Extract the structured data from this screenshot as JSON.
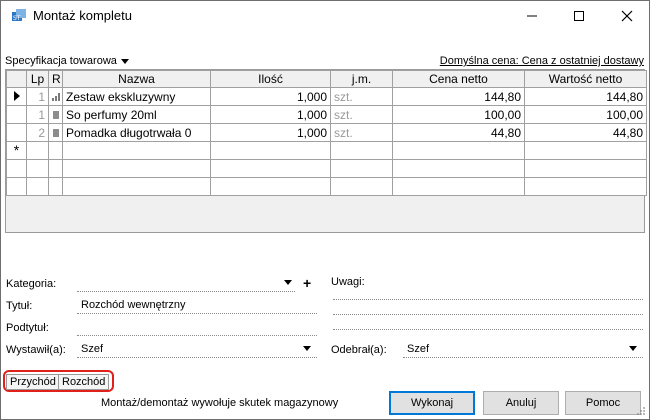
{
  "window": {
    "title": "Montaż kompletu"
  },
  "toolbar": {
    "spec_dropdown": "Specyfikacja towarowa",
    "default_price": "Domyślna cena: Cena z ostatniej dostawy"
  },
  "table": {
    "columns": [
      "Lp",
      "R",
      "Nazwa",
      "Ilość",
      "j.m.",
      "Cena netto",
      "Wartość netto"
    ],
    "rows": [
      {
        "lp": "1",
        "name": "Zestaw ekskluzywny",
        "qty": "1,000",
        "unit": "szt.",
        "price": "144,80",
        "value": "144,80"
      },
      {
        "lp": "1",
        "name": "So perfumy 20ml",
        "qty": "1,000",
        "unit": "szt.",
        "price": "100,00",
        "value": "100,00"
      },
      {
        "lp": "2",
        "name": "Pomadka długotrwała 0",
        "qty": "1,000",
        "unit": "szt.",
        "price": "44,80",
        "value": "44,80"
      }
    ]
  },
  "form": {
    "kategoria_label": "Kategoria:",
    "kategoria_value": "",
    "tytul_label": "Tytuł:",
    "tytul_value": "Rozchód wewnętrzny",
    "podtytul_label": "Podtytuł:",
    "podtytul_value": "",
    "wystawil_label": "Wystawił(a):",
    "wystawil_value": "Szef",
    "uwagi_label": "Uwagi:",
    "odebral_label": "Odebrał(a):",
    "odebral_value": "Szef"
  },
  "tabs": {
    "przychod": "Przychód",
    "rozchod": "Rozchód"
  },
  "footer": {
    "status": "Montaż/demontaż wywołuje skutek magazynowy",
    "wykonaj": "Wykonaj",
    "anuluj": "Anuluj",
    "pomoc": "Pomoc"
  },
  "colors": {
    "highlight": "#e0201b",
    "default_button_border": "#0078d7"
  }
}
